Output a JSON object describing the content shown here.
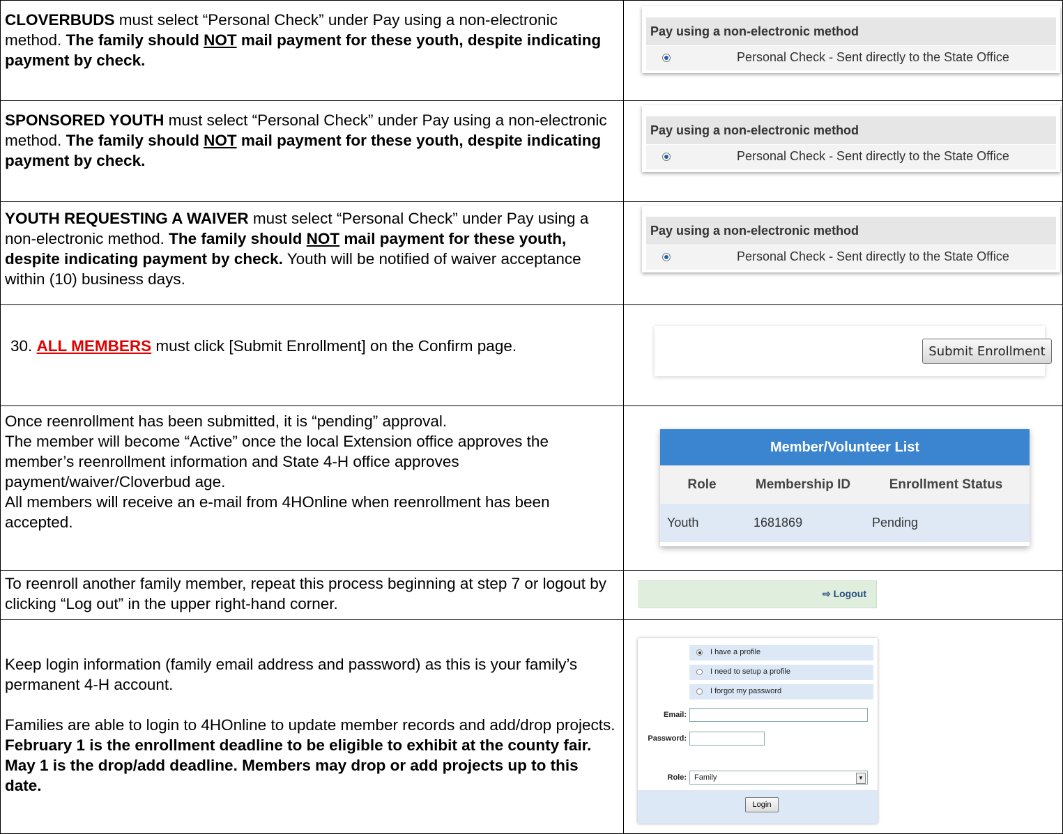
{
  "row1": {
    "lead": "CLOVERBUDS",
    "t1": " must select “Personal Check” under Pay using a non-electronic method.  ",
    "b1": "The family should ",
    "not": "NOT",
    "b2": " mail payment for these youth, despite indicating payment by check."
  },
  "row2": {
    "lead": "SPONSORED YOUTH",
    "t1": " must select “Personal Check” under Pay using a non-electronic method.  ",
    "b1": "The family should ",
    "not": "NOT",
    "b2": " mail payment for these youth, despite indicating payment by check."
  },
  "row3": {
    "lead": "YOUTH REQUESTING A WAIVER",
    "t1": " must select “Personal Check” under Pay using a non-electronic method.  ",
    "b1": "The family should ",
    "not": "NOT",
    "b2": " mail payment for these youth, despite indicating payment by check.",
    "t2": "  Youth will be notified of waiver acceptance within (10) business days."
  },
  "pay_widget": {
    "header": "Pay using a non-electronic method",
    "option": "Personal Check - Sent directly to the State Office"
  },
  "row4": {
    "num": "30.",
    "lead": "ALL MEMBERS",
    "t1": " must click [Submit Enrollment] on the Confirm page.",
    "button": "Submit Enrollment"
  },
  "row5": {
    "lines": [
      "Once reenrollment has been submitted, it is “pending” approval.",
      "The member will become “Active” once the local Extension office approves the member’s reenrollment information and State 4-H office approves payment/waiver/Cloverbud age.",
      "All members will receive an e-mail from 4HOnline when reenrollment has been accepted."
    ]
  },
  "member_list": {
    "title": "Member/Volunteer List",
    "headers": [
      "Role",
      "Membership ID",
      "Enrollment Status"
    ],
    "row": [
      "Youth",
      "1681869",
      "Pending"
    ]
  },
  "row6": {
    "text": "To reenroll another family member, repeat this process beginning at step 7 or logout by clicking “Log out” in the upper right-hand corner.",
    "logout": "Logout"
  },
  "row7": {
    "p1": "Keep login information (family email address and password) as this is your family’s permanent 4-H account.",
    "p2": "Families are able to login to 4HOnline to update member records and add/drop projects.  ",
    "p2b": "February 1 is the enrollment deadline to be eligible to exhibit at the county fair.  May 1 is the drop/add deadline.  Members may drop or add projects up to this date."
  },
  "login": {
    "options": [
      "I have a profile",
      "I need to setup a profile",
      "I forgot my password"
    ],
    "email_label": "Email:",
    "password_label": "Password:",
    "role_label": "Role:",
    "role_value": "Family",
    "button": "Login"
  }
}
